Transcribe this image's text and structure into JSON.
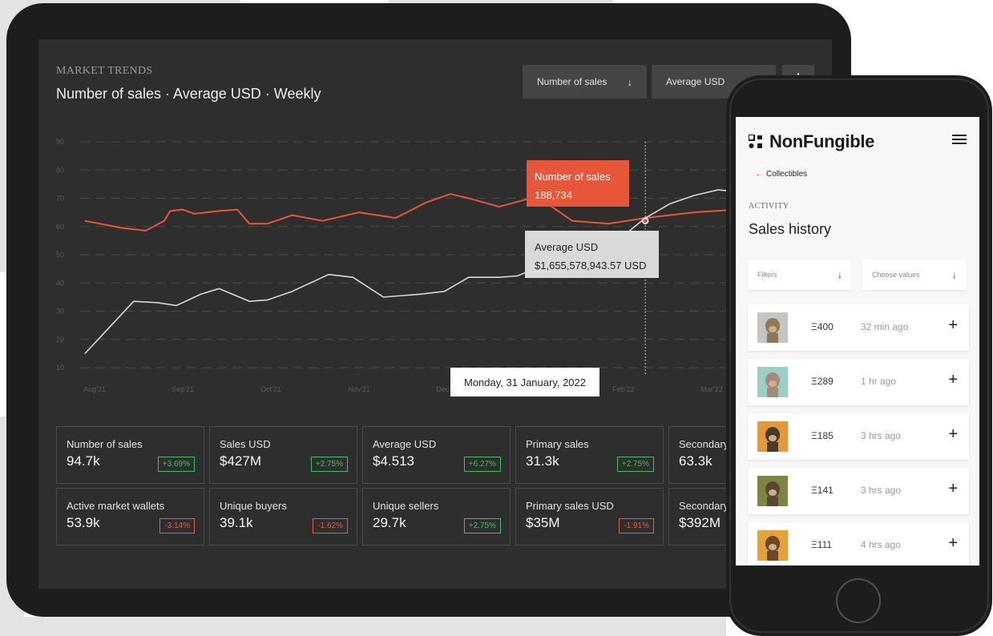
{
  "dashboard": {
    "kicker": "MARKET TRENDS",
    "title": "Number of sales · Average USD · Weekly",
    "dropdown_primary": "Number of sales",
    "dropdown_secondary": "Average USD",
    "tooltip_sales_label": "Number of sales",
    "tooltip_sales_value": "188,734",
    "tooltip_avg_label": "Average USD",
    "tooltip_avg_value": "$1,655,578,943.57 USD",
    "tooltip_date": "Monday, 31 January, 2022"
  },
  "chart_data": {
    "type": "line",
    "y_ticks": [
      "90",
      "80",
      "70",
      "60",
      "50",
      "40",
      "30",
      "20",
      "10"
    ],
    "x_ticks": [
      "Aug'21",
      "Sep'21",
      "Oct'21",
      "Nov'21",
      "Dec'21",
      "Jan'22",
      "Feb'22",
      "Mar'22"
    ],
    "ylim": [
      10,
      90
    ],
    "colors": {
      "sales": "#e8563a",
      "average": "#d8d8d8"
    },
    "series": [
      {
        "key": "sales",
        "values": [
          [
            0.0,
            62
          ],
          [
            0.06,
            59.5
          ],
          [
            0.1,
            58.5
          ],
          [
            0.13,
            62
          ],
          [
            0.14,
            65.5
          ],
          [
            0.16,
            66
          ],
          [
            0.18,
            64.5
          ],
          [
            0.22,
            65.5
          ],
          [
            0.25,
            66
          ],
          [
            0.27,
            61
          ],
          [
            0.3,
            61
          ],
          [
            0.34,
            64
          ],
          [
            0.39,
            62
          ],
          [
            0.45,
            65
          ],
          [
            0.51,
            63
          ],
          [
            0.56,
            68.5
          ],
          [
            0.6,
            71.5
          ],
          [
            0.63,
            70
          ],
          [
            0.68,
            67
          ],
          [
            0.74,
            70.5
          ],
          [
            0.76,
            68
          ],
          [
            0.8,
            62
          ],
          [
            0.86,
            61
          ],
          [
            0.92,
            63
          ],
          [
            1.0,
            65
          ],
          [
            1.07,
            66
          ],
          [
            1.13,
            76
          ],
          [
            1.17,
            81
          ],
          [
            1.26,
            81
          ]
        ]
      },
      {
        "key": "average",
        "values": [
          [
            0.0,
            15
          ],
          [
            0.08,
            33.5
          ],
          [
            0.12,
            33
          ],
          [
            0.15,
            32
          ],
          [
            0.19,
            36
          ],
          [
            0.22,
            38
          ],
          [
            0.27,
            33.5
          ],
          [
            0.3,
            34
          ],
          [
            0.34,
            37
          ],
          [
            0.4,
            43
          ],
          [
            0.44,
            42
          ],
          [
            0.49,
            35
          ],
          [
            0.55,
            36
          ],
          [
            0.59,
            37
          ],
          [
            0.63,
            42
          ],
          [
            0.68,
            42
          ],
          [
            0.71,
            42.5
          ],
          [
            0.76,
            47
          ],
          [
            0.84,
            47.5
          ],
          [
            0.88,
            56
          ],
          [
            0.92,
            63
          ],
          [
            0.96,
            68
          ],
          [
            1.0,
            71
          ],
          [
            1.04,
            73
          ],
          [
            1.1,
            71.5
          ],
          [
            1.18,
            79
          ],
          [
            1.22,
            82.5
          ],
          [
            1.26,
            83
          ]
        ]
      }
    ],
    "highlight": {
      "x": 0.92,
      "y": 62
    }
  },
  "stats": [
    {
      "label": "Number of sales",
      "value": "94.7k",
      "change": "+3.69%",
      "dir": "up"
    },
    {
      "label": "Sales USD",
      "value": "$427M",
      "change": "+2.75%",
      "dir": "up"
    },
    {
      "label": "Average USD",
      "value": "$4.513",
      "change": "+6.27%",
      "dir": "up"
    },
    {
      "label": "Primary sales",
      "value": "31.3k",
      "change": "+2.75%",
      "dir": "up"
    },
    {
      "label": "Secondary",
      "value": "63.3k",
      "change": "",
      "dir": ""
    },
    {
      "label": "Active market wallets",
      "value": "53.9k",
      "change": "-3.14%",
      "dir": "down"
    },
    {
      "label": "Unique buyers",
      "value": "39.1k",
      "change": "-1.62%",
      "dir": "down"
    },
    {
      "label": "Unique sellers",
      "value": "29.7k",
      "change": "+2.75%",
      "dir": "up"
    },
    {
      "label": "Primary sales USD",
      "value": "$35M",
      "change": "-1.91%",
      "dir": "down"
    },
    {
      "label": "Secondary",
      "value": "$392M",
      "change": "",
      "dir": ""
    }
  ],
  "mobile": {
    "brand": "NonFungible",
    "back_label": "Collectibles",
    "section_kicker": "ACTIVITY",
    "section_title": "Sales history",
    "filter_label": "Filters",
    "values_label": "Choose values",
    "items": [
      {
        "price": "Ξ400",
        "time": "32 min ago",
        "bg": "#c4c4c0",
        "fur": "#8a7a5a"
      },
      {
        "price": "Ξ289",
        "time": "1 hr ago",
        "bg": "#9ccfc6",
        "fur": "#a48a7a"
      },
      {
        "price": "Ξ185",
        "time": "3 hrs ago",
        "bg": "#e49a3a",
        "fur": "#4a3a28"
      },
      {
        "price": "Ξ141",
        "time": "3 hrs ago",
        "bg": "#7e8446",
        "fur": "#5a4632"
      },
      {
        "price": "Ξ111",
        "time": "4 hrs ago",
        "bg": "#e4a23a",
        "fur": "#6a4828"
      }
    ]
  }
}
